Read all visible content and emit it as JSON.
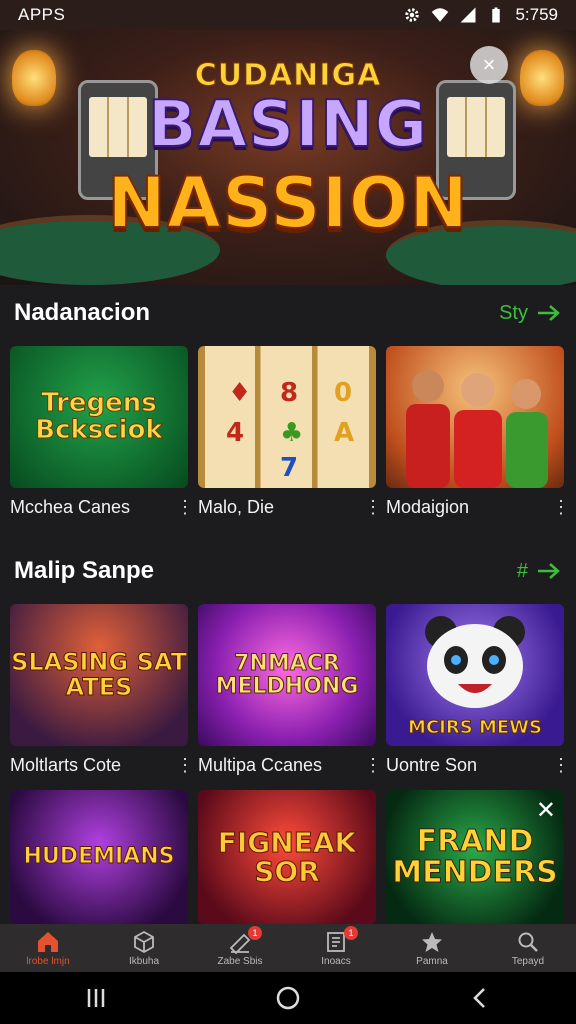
{
  "status_bar": {
    "carrier": "APPS",
    "time": "5:759"
  },
  "hero": {
    "title_line1": "CUDANIGA",
    "title_line2": "BASING",
    "title_line3": "NASSION",
    "close_label": "×"
  },
  "sections": [
    {
      "title": "Nadanacion",
      "more_label": "Sty",
      "games": [
        {
          "name": "Mcchea Canes",
          "art_text": "Tregens Bcksciok",
          "colors": [
            "#0f7a34",
            "#064a1e"
          ]
        },
        {
          "name": "Malo, Die",
          "art_text": "",
          "colors": [
            "#f3dfb2",
            "#b88a3c"
          ]
        },
        {
          "name": "Modaigion",
          "art_text": "",
          "colors": [
            "#f0a64a",
            "#8a3a1a"
          ]
        }
      ]
    },
    {
      "title": "Malip Sanpe",
      "more_label": "#",
      "games": [
        {
          "name": "Moltlarts Cote",
          "art_text": "SLASING SAT ATES",
          "colors": [
            "#c2401e",
            "#3a1a40"
          ]
        },
        {
          "name": "Multipa Ccanes",
          "art_text": "7NMACR MELDHONG",
          "colors": [
            "#c03ad0",
            "#4a1070"
          ]
        },
        {
          "name": "Uontre Son",
          "art_text": "MCIRS MEWS",
          "colors": [
            "#7a4ad8",
            "#2a1060"
          ]
        }
      ]
    },
    {
      "title": "",
      "more_label": "",
      "games": [
        {
          "name": "",
          "art_text": "HUDEMIANS",
          "colors": [
            "#8a2ac8",
            "#2a0a40"
          ]
        },
        {
          "name": "",
          "art_text": "FIGNEAK SOR",
          "colors": [
            "#d02a2a",
            "#5a0a1a"
          ]
        },
        {
          "name": "",
          "art_text": "FRAND MENDERS",
          "colors": [
            "#1a8a3a",
            "#052a12"
          ]
        }
      ]
    }
  ],
  "bottom_nav": [
    {
      "label": "lrobe lmjn",
      "icon": "home-icon",
      "badge": ""
    },
    {
      "label": "Ikbuha",
      "icon": "cube-icon",
      "badge": ""
    },
    {
      "label": "Zabe Sbis",
      "icon": "ticket-icon",
      "badge": "1"
    },
    {
      "label": "Inoacs",
      "icon": "document-icon",
      "badge": "1"
    },
    {
      "label": "Pamna",
      "icon": "star-icon",
      "badge": ""
    },
    {
      "label": "Tepayd",
      "icon": "search-icon",
      "badge": ""
    }
  ],
  "accent_color": "#3bbf3b",
  "active_color": "#e2542e"
}
